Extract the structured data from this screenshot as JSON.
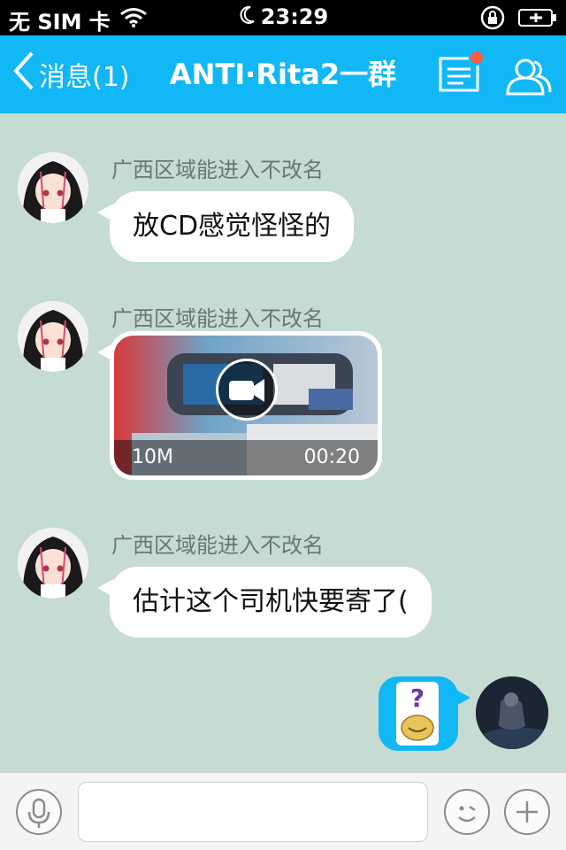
{
  "status_bar": {
    "carrier": "无 SIM 卡",
    "time": "23:29"
  },
  "nav": {
    "back_label": "消息(1)",
    "title": "ANTI·Rita2一群"
  },
  "chat": {
    "messages": [
      {
        "sender": "广西区域能进入不改名",
        "type": "text",
        "text": "放CD感觉怪怪的"
      },
      {
        "sender": "广西区域能进入不改名",
        "type": "video",
        "size": "10M",
        "duration": "00:20"
      },
      {
        "sender": "广西区域能进入不改名",
        "type": "text",
        "text": "估计这个司机快要寄了("
      },
      {
        "sender": "self",
        "type": "sticker",
        "text": "?"
      }
    ]
  },
  "input": {
    "placeholder": ""
  },
  "colors": {
    "accent": "#12b7f5",
    "chat_bg": "#c6dcd3",
    "notification": "#ff5b3b"
  }
}
